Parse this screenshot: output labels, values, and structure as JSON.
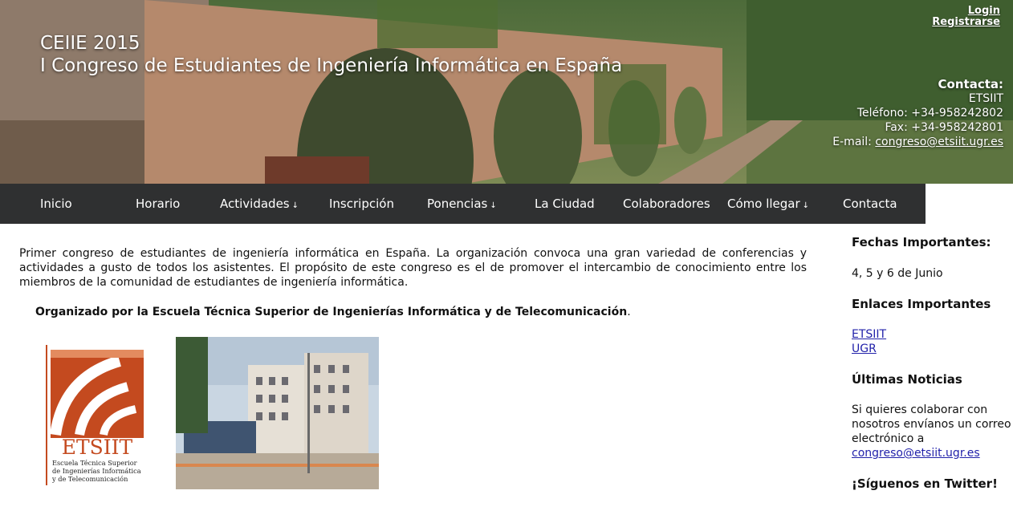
{
  "header": {
    "title_line1": "CEIIE 2015",
    "title_line2": "I Congreso de Estudiantes de Ingeniería Informática en España",
    "login": "Login",
    "register": "Registrarse",
    "contact": {
      "title": "Contacta:",
      "org": "ETSIIT",
      "phone": "Teléfono: +34-958242802",
      "fax": "Fax: +34-958242801",
      "email_label": "E-mail: ",
      "email": "congreso@etsiit.ugr.es"
    }
  },
  "nav": {
    "items": [
      {
        "label": "Inicio",
        "dropdown": false
      },
      {
        "label": "Horario",
        "dropdown": false
      },
      {
        "label": "Actividades",
        "dropdown": true
      },
      {
        "label": "Inscripción",
        "dropdown": false
      },
      {
        "label": "Ponencias",
        "dropdown": true
      },
      {
        "label": "La Ciudad",
        "dropdown": false
      },
      {
        "label": "Colaboradores",
        "dropdown": false
      },
      {
        "label": "Cómo llegar",
        "dropdown": true
      },
      {
        "label": "Contacta",
        "dropdown": false
      }
    ],
    "dropdown_arrow": "↓"
  },
  "main": {
    "intro": "Primer congreso de estudiantes de ingeniería informática en España. La organización convoca una gran variedad de conferencias y actividades a gusto de todos los asistentes. El propósito de este congreso es el de promover el intercambio de conocimiento entre los miembros de la comunidad de estudiantes de ingeniería informática.",
    "organizer": "Organizado por la Escuela Técnica Superior de Ingenierías Informática y de Telecomunicación",
    "organizer_end": ".",
    "logo": {
      "acronym": "ETSIIT",
      "line1": "Escuela Técnica Superior",
      "line2": "de Ingenierías Informática",
      "line3": "y de Telecomunicación"
    }
  },
  "sidebar": {
    "dates_title": "Fechas Importantes:",
    "dates": "4, 5 y 6 de Junio",
    "links_title": "Enlaces Importantes",
    "links": [
      "ETSIIT",
      "UGR"
    ],
    "news_title": "Últimas Noticias",
    "news_text": "Si quieres colaborar con nosotros envíanos un correo electrónico a",
    "news_email": "congreso@etsiit.ugr.es",
    "twitter_title": "¡Síguenos en Twitter!"
  },
  "colors": {
    "nav_bg": "#2f3031",
    "link": "#2222aa",
    "logo_orange": "#c44a1f"
  }
}
